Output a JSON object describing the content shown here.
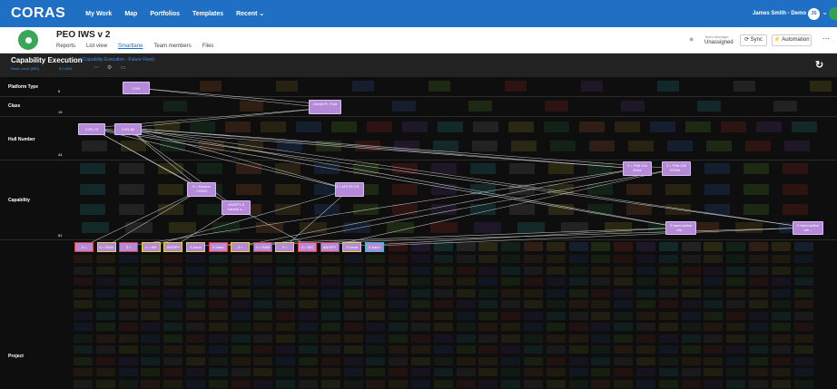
{
  "nav": {
    "logo": "CORAS",
    "links": [
      "My Work",
      "Map",
      "Portfolios",
      "Templates",
      "Recent ⌄"
    ],
    "user": "James Smith - Demo",
    "avatar": "JS"
  },
  "header": {
    "title": "PEO IWS v 2",
    "tabs": [
      "Reports",
      "List view",
      "Smartlane",
      "Team members",
      "Files"
    ],
    "active_tab": "Smartlane",
    "team_manager_label": "Team Manager",
    "team_manager_value": "Unassigned",
    "sync_label": "⟳ Sync",
    "automation_label": "⚡ Automation",
    "more": "⋯"
  },
  "capability": {
    "title": "Capability Execution",
    "subtitle": "(Capability Execution - Future Fleet)",
    "node_count": "Node count (600)",
    "cost": "$ 0.00M"
  },
  "lanes": [
    {
      "name": "Platform Type",
      "count": "5"
    },
    {
      "name": "Class",
      "count": "15"
    },
    {
      "name": "Hull Number",
      "count": "44"
    },
    {
      "name": "Capability",
      "count": "81"
    },
    {
      "name": "Project",
      "count": ""
    }
  ],
  "nodes": {
    "cvn": "CVN",
    "gerald": "Gerald R. Ford",
    "cvn79": "CVN-79",
    "cvn80": "CVN-80",
    "ssds": "3 = Modern CSWS",
    "an_spy": "AN/SPY-6 volume s...",
    "ring_ciwss": "4 = MS 09 CS ...",
    "rim116": "3 = RIM-116 RAM",
    "rim162": "3 = RIM-162 ESSM...",
    "sband": "S band active ele...",
    "xband": "X band active ele..."
  },
  "projects": [
    "3 =",
    "3 = RAM",
    "3 =",
    "4 = MS",
    "AN/SPY",
    "S band",
    "X band",
    "3 =",
    "3 = RAM",
    "3 =",
    "4 = MS",
    "AN/SPY",
    "S band",
    "X band"
  ],
  "colors": {
    "accent": "#1f6fc5",
    "node": "#b58ad8",
    "red_border": "#e0413c",
    "yellow_border": "#e8d43b",
    "cyan_border": "#3fbdc9"
  }
}
